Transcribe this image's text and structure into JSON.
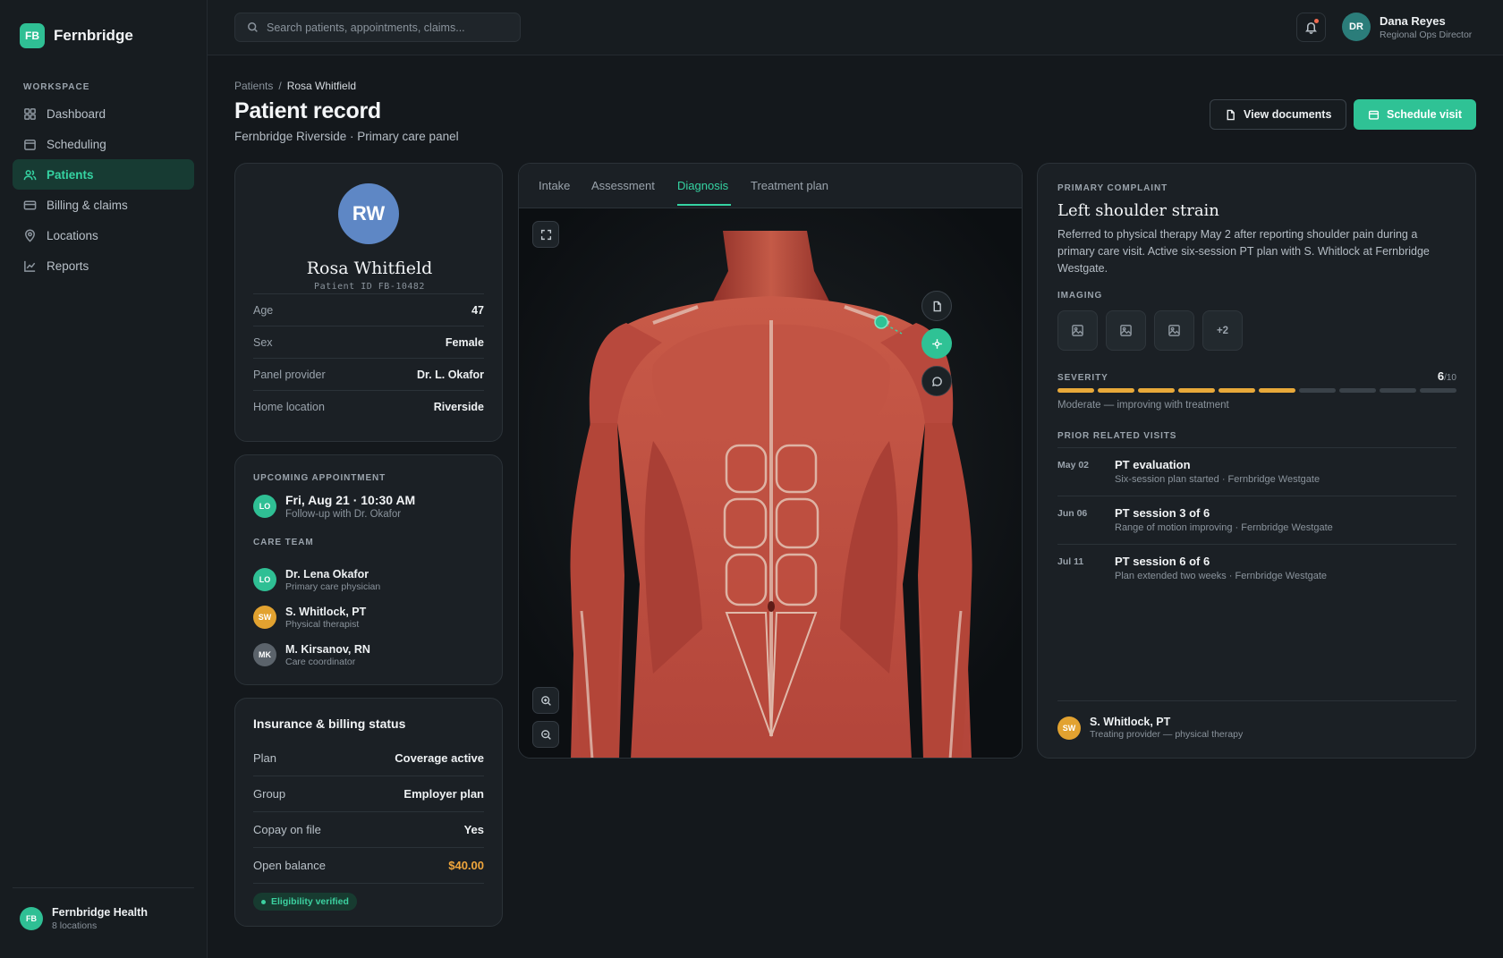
{
  "app": {
    "logo_initials": "FB",
    "name": "Fernbridge",
    "workspace_label": "WORKSPACE",
    "nav": [
      {
        "label": "Dashboard",
        "icon": "grid-icon"
      },
      {
        "label": "Scheduling",
        "icon": "calendar-icon"
      },
      {
        "label": "Patients",
        "icon": "users-icon",
        "active": true
      },
      {
        "label": "Billing & claims",
        "icon": "credit-card-icon"
      },
      {
        "label": "Locations",
        "icon": "map-pin-icon"
      },
      {
        "label": "Reports",
        "icon": "line-chart-icon"
      }
    ],
    "org": {
      "initials": "FB",
      "name": "Fernbridge Health",
      "sub": "8 locations"
    }
  },
  "topbar": {
    "search_placeholder": "Search patients, appointments, claims...",
    "user": {
      "initials": "DR",
      "name": "Dana Reyes",
      "role": "Regional Ops Director"
    }
  },
  "header": {
    "breadcrumb": [
      "Patients",
      "Rosa Whitfield"
    ],
    "title": "Patient record",
    "subtitle": "Fernbridge Riverside · Primary care panel",
    "view_documents": "View documents",
    "schedule_visit": "Schedule visit"
  },
  "patient": {
    "initials": "RW",
    "name": "Rosa Whitfield",
    "id_line": "Patient ID FB-10482",
    "fields": [
      {
        "k": "Age",
        "v": "47"
      },
      {
        "k": "Sex",
        "v": "Female"
      },
      {
        "k": "Panel provider",
        "v": "Dr. L. Okafor"
      },
      {
        "k": "Home location",
        "v": "Riverside"
      }
    ]
  },
  "appointment": {
    "label": "UPCOMING APPOINTMENT",
    "initials": "LO",
    "date": "Fri, Aug 21 · 10:30 AM",
    "sub": "Follow-up with Dr. Okafor",
    "care_team_label": "CARE TEAM",
    "team": [
      {
        "initials": "LO",
        "name": "Dr. Lena Okafor",
        "role": "Primary care physician",
        "color": "#2fbf94"
      },
      {
        "initials": "SW",
        "name": "S. Whitlock, PT",
        "role": "Physical therapist",
        "color": "#e2a230"
      },
      {
        "initials": "MK",
        "name": "M. Kirsanov, RN",
        "role": "Care coordinator",
        "color": "#5b636b"
      }
    ]
  },
  "insurance": {
    "title": "Insurance & billing status",
    "rows": [
      {
        "k": "Plan",
        "v": "Coverage active"
      },
      {
        "k": "Group",
        "v": "Employer plan"
      },
      {
        "k": "Copay on file",
        "v": "Yes"
      },
      {
        "k": "Open balance",
        "v": "$40.00"
      }
    ],
    "badge": "Eligibility verified"
  },
  "viewer": {
    "tabs": [
      "Intake",
      "Assessment",
      "Diagnosis",
      "Treatment plan"
    ],
    "active_tab": "Diagnosis"
  },
  "complaint": {
    "label": "PRIMARY COMPLAINT",
    "title": "Left shoulder strain",
    "description": "Referred to physical therapy May 2 after reporting shoulder pain during a primary care visit. Active six-session PT plan with S. Whitlock at Fernbridge Westgate.",
    "imaging_label": "IMAGING",
    "imaging_more": "+2",
    "severity_label": "SEVERITY",
    "severity_value": "6",
    "severity_max": "/10",
    "severity_note": "Moderate — improving with treatment",
    "visits_label": "PRIOR RELATED VISITS",
    "visits": [
      {
        "date": "May 02",
        "title": "PT evaluation",
        "sub": "Six-session plan started · Fernbridge Westgate"
      },
      {
        "date": "Jun 06",
        "title": "PT session 3 of 6",
        "sub": "Range of motion improving · Fernbridge Westgate"
      },
      {
        "date": "Jul 11",
        "title": "PT session 6 of 6",
        "sub": "Plan extended two weeks · Fernbridge Westgate"
      }
    ],
    "provider": {
      "initials": "SW",
      "name": "S. Whitlock, PT",
      "role": "Treating provider — physical therapy"
    }
  },
  "colors": {
    "accent": "#2fc295",
    "amber": "#f0a63c",
    "background": "#14181c"
  }
}
